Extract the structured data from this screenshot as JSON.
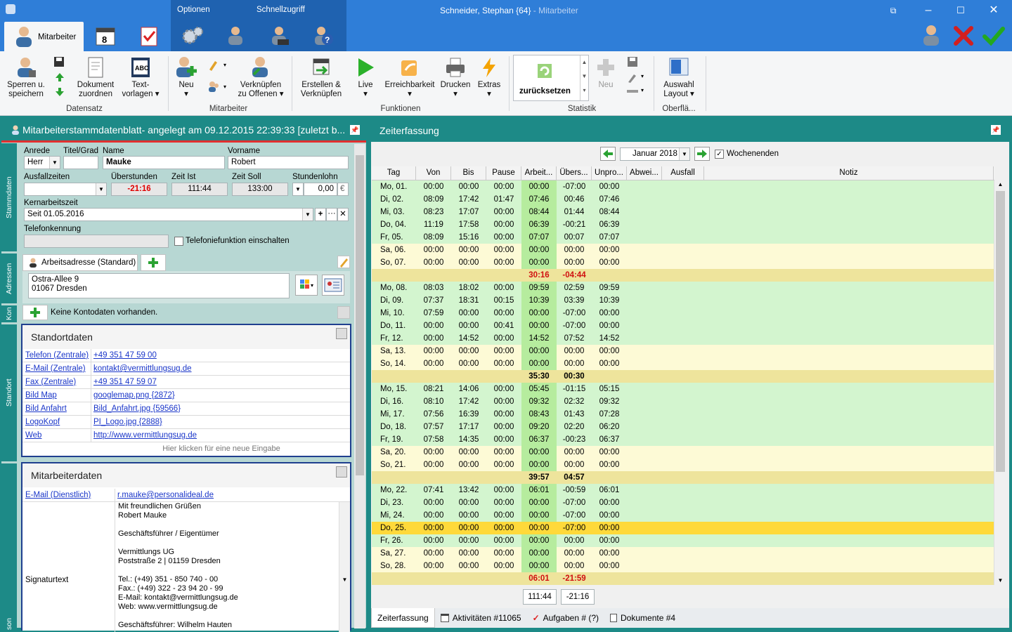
{
  "window": {
    "title": "Schneider, Stephan {64}",
    "subtitle": " - Mitarbeiter"
  },
  "topnav": {
    "tab_mitarbeiter": "Mitarbeiter",
    "optionen": "Optionen",
    "schnellzugriff": "Schnellzugriff"
  },
  "ribbon": {
    "sperren": "Sperren u.",
    "speichern": "speichern",
    "dokument1": "Dokument",
    "dokument2": "zuordnen",
    "text1": "Text-",
    "text2": "vorlagen",
    "neu": "Neu",
    "verkn1": "Verknüpfen",
    "verkn2": "zu Offenen",
    "erstellen1": "Erstellen &",
    "erstellen2": "Verknüpfen",
    "live": "Live",
    "erreich": "Erreichbarkeit",
    "drucken": "Drucken",
    "extras": "Extras",
    "zuruecksetzen": "zurücksetzen",
    "neu2": "Neu",
    "auswahl1": "Auswahl",
    "auswahl2": "Layout",
    "groups": {
      "datensatz": "Datensatz",
      "mitarbeiter": "Mitarbeiter",
      "funktionen": "Funktionen",
      "statistik": "Statistik",
      "oberflaeche": "Oberflä..."
    }
  },
  "left_panel": {
    "title": "Mitarbeiterstammdatenblatt- angelegt am 09.12.2015 22:39:33 [zuletzt b...",
    "side_tabs": {
      "stammdaten": "Stammdaten",
      "adressen": "Adressen",
      "kon": "Kon",
      "standort": "Standort",
      "son": "son"
    },
    "labels": {
      "anrede": "Anrede",
      "titel": "Titel/Grad",
      "name": "Name",
      "vorname": "Vorname",
      "ausfallzeiten": "Ausfallzeiten",
      "ueberstunden": "Überstunden",
      "zeit_ist": "Zeit Ist",
      "zeit_soll": "Zeit Soll",
      "stundenlohn": "Stundenlohn",
      "kernarbeitszeit": "Kernarbeitszeit",
      "telefonkennung": "Telefonkennung",
      "telefonie": "Telefoniefunktion einschalten"
    },
    "values": {
      "anrede": "Herr",
      "titel": "",
      "name": "Mauke",
      "vorname": "Robert",
      "ausfallzeiten": "",
      "ueberstunden": "-21:16",
      "zeit_ist": "111:44",
      "zeit_soll": "133:00",
      "stundenlohn": "0,00",
      "waehrung": "€",
      "kernarbeitszeit": "Seit 01.05.2016",
      "telefonkennung": ""
    },
    "adresse": {
      "tab": "Arbeitsadresse (Standard)",
      "line1": "Ostra-Allee 9",
      "line2": "01067 Dresden"
    },
    "konto": "Keine Kontodaten vorhanden.",
    "standort": {
      "title": "Standortdaten",
      "rows": [
        {
          "k": "Telefon (Zentrale)",
          "v": "+49 351 47 59 00"
        },
        {
          "k": "E-Mail (Zentrale)",
          "v": "kontakt@vermittlungsug.de"
        },
        {
          "k": "Fax (Zentrale)",
          "v": "+49 351 47 59 07"
        },
        {
          "k": "Bild Map",
          "v": "googlemap.png {2872}"
        },
        {
          "k": "Bild Anfahrt",
          "v": "Bild_Anfahrt.jpg {59566}"
        },
        {
          "k": "LogoKopf",
          "v": "PI_Logo.jpg {2888}"
        },
        {
          "k": "Web",
          "v": "http://www.vermittlungsug.de"
        }
      ],
      "new_entry": "Hier klicken für eine neue Eingabe"
    },
    "mitarbeiter": {
      "title": "Mitarbeiterdaten",
      "email_k": "E-Mail (Dienstlich)",
      "email_v": "r.mauke@personalideal.de",
      "sig_k": "Signaturtext",
      "sig_lines": [
        "Mit freundlichen Grüßen",
        "Robert Mauke",
        "",
        "Geschäftsführer / Eigentümer",
        "",
        "Vermittlungs UG",
        "Poststraße 2 | 01159 Dresden",
        "",
        "Tel.: (+49) 351 - 850 740 - 00",
        "Fax.: (+49) 322 - 23 94 20 - 99",
        "E-Mail: kontakt@vermittlungsug.de",
        "Web: www.vermittlungsug.de",
        "",
        "Geschäftsführer: Wilhelm Hauten"
      ]
    }
  },
  "right_panel": {
    "title": "Zeiterfassung",
    "month": "Januar 2018",
    "wochenenden": "Wochenenden",
    "headers": [
      "Tag",
      "Von",
      "Bis",
      "Pause",
      "Arbeit...",
      "Übers...",
      "Unpro...",
      "Abwei...",
      "Ausfall",
      "Notiz"
    ],
    "total_ist": "111:44",
    "total_ueber": "-21:16",
    "tabs": [
      "Zeiterfassung",
      "Aktivitäten #11065",
      "Aufgaben # (?)",
      "Dokumente #4"
    ]
  },
  "time_rows": [
    {
      "t": "d",
      "tag": "Mo, 01.",
      "von": "00:00",
      "bis": "00:00",
      "pause": "00:00",
      "arbeit": "00:00",
      "ueber": "-07:00",
      "unpro": "00:00"
    },
    {
      "t": "d",
      "tag": "Di, 02.",
      "von": "08:09",
      "bis": "17:42",
      "pause": "01:47",
      "arbeit": "07:46",
      "ueber": "00:46",
      "unpro": "07:46"
    },
    {
      "t": "d",
      "tag": "Mi, 03.",
      "von": "08:23",
      "bis": "17:07",
      "pause": "00:00",
      "arbeit": "08:44",
      "ueber": "01:44",
      "unpro": "08:44"
    },
    {
      "t": "d",
      "tag": "Do, 04.",
      "von": "11:19",
      "bis": "17:58",
      "pause": "00:00",
      "arbeit": "06:39",
      "ueber": "-00:21",
      "unpro": "06:39"
    },
    {
      "t": "d",
      "tag": "Fr, 05.",
      "von": "08:09",
      "bis": "15:16",
      "pause": "00:00",
      "arbeit": "07:07",
      "ueber": "00:07",
      "unpro": "07:07"
    },
    {
      "t": "w",
      "tag": "Sa, 06.",
      "von": "00:00",
      "bis": "00:00",
      "pause": "00:00",
      "arbeit": "00:00",
      "ueber": "00:00",
      "unpro": "00:00"
    },
    {
      "t": "w",
      "tag": "So, 07.",
      "von": "00:00",
      "bis": "00:00",
      "pause": "00:00",
      "arbeit": "00:00",
      "ueber": "00:00",
      "unpro": "00:00"
    },
    {
      "t": "s",
      "arbeit": "30:16",
      "ueber": "-04:44",
      "red": true
    },
    {
      "t": "d",
      "tag": "Mo, 08.",
      "von": "08:03",
      "bis": "18:02",
      "pause": "00:00",
      "arbeit": "09:59",
      "ueber": "02:59",
      "unpro": "09:59"
    },
    {
      "t": "d",
      "tag": "Di, 09.",
      "von": "07:37",
      "bis": "18:31",
      "pause": "00:15",
      "arbeit": "10:39",
      "ueber": "03:39",
      "unpro": "10:39"
    },
    {
      "t": "d",
      "tag": "Mi, 10.",
      "von": "07:59",
      "bis": "00:00",
      "pause": "00:00",
      "arbeit": "00:00",
      "ueber": "-07:00",
      "unpro": "00:00"
    },
    {
      "t": "d",
      "tag": "Do, 11.",
      "von": "00:00",
      "bis": "00:00",
      "pause": "00:41",
      "arbeit": "00:00",
      "ueber": "-07:00",
      "unpro": "00:00"
    },
    {
      "t": "d",
      "tag": "Fr, 12.",
      "von": "00:00",
      "bis": "14:52",
      "pause": "00:00",
      "arbeit": "14:52",
      "ueber": "07:52",
      "unpro": "14:52"
    },
    {
      "t": "w",
      "tag": "Sa, 13.",
      "von": "00:00",
      "bis": "00:00",
      "pause": "00:00",
      "arbeit": "00:00",
      "ueber": "00:00",
      "unpro": "00:00"
    },
    {
      "t": "w",
      "tag": "So, 14.",
      "von": "00:00",
      "bis": "00:00",
      "pause": "00:00",
      "arbeit": "00:00",
      "ueber": "00:00",
      "unpro": "00:00"
    },
    {
      "t": "s",
      "arbeit": "35:30",
      "ueber": "00:30",
      "red": false
    },
    {
      "t": "d",
      "tag": "Mo, 15.",
      "von": "08:21",
      "bis": "14:06",
      "pause": "00:00",
      "arbeit": "05:45",
      "ueber": "-01:15",
      "unpro": "05:15"
    },
    {
      "t": "d",
      "tag": "Di, 16.",
      "von": "08:10",
      "bis": "17:42",
      "pause": "00:00",
      "arbeit": "09:32",
      "ueber": "02:32",
      "unpro": "09:32"
    },
    {
      "t": "d",
      "tag": "Mi, 17.",
      "von": "07:56",
      "bis": "16:39",
      "pause": "00:00",
      "arbeit": "08:43",
      "ueber": "01:43",
      "unpro": "07:28"
    },
    {
      "t": "d",
      "tag": "Do, 18.",
      "von": "07:57",
      "bis": "17:17",
      "pause": "00:00",
      "arbeit": "09:20",
      "ueber": "02:20",
      "unpro": "06:20"
    },
    {
      "t": "d",
      "tag": "Fr, 19.",
      "von": "07:58",
      "bis": "14:35",
      "pause": "00:00",
      "arbeit": "06:37",
      "ueber": "-00:23",
      "unpro": "06:37"
    },
    {
      "t": "w",
      "tag": "Sa, 20.",
      "von": "00:00",
      "bis": "00:00",
      "pause": "00:00",
      "arbeit": "00:00",
      "ueber": "00:00",
      "unpro": "00:00"
    },
    {
      "t": "w",
      "tag": "So, 21.",
      "von": "00:00",
      "bis": "00:00",
      "pause": "00:00",
      "arbeit": "00:00",
      "ueber": "00:00",
      "unpro": "00:00"
    },
    {
      "t": "s",
      "arbeit": "39:57",
      "ueber": "04:57",
      "red": false
    },
    {
      "t": "d",
      "tag": "Mo, 22.",
      "von": "07:41",
      "bis": "13:42",
      "pause": "00:00",
      "arbeit": "06:01",
      "ueber": "-00:59",
      "unpro": "06:01"
    },
    {
      "t": "d",
      "tag": "Di, 23.",
      "von": "00:00",
      "bis": "00:00",
      "pause": "00:00",
      "arbeit": "00:00",
      "ueber": "-07:00",
      "unpro": "00:00"
    },
    {
      "t": "d",
      "tag": "Mi, 24.",
      "von": "00:00",
      "bis": "00:00",
      "pause": "00:00",
      "arbeit": "00:00",
      "ueber": "-07:00",
      "unpro": "00:00"
    },
    {
      "t": "h",
      "tag": "Do, 25.",
      "von": "00:00",
      "bis": "00:00",
      "pause": "00:00",
      "arbeit": "00:00",
      "ueber": "-07:00",
      "unpro": "00:00"
    },
    {
      "t": "d",
      "tag": "Fr, 26.",
      "von": "00:00",
      "bis": "00:00",
      "pause": "00:00",
      "arbeit": "00:00",
      "ueber": "00:00",
      "unpro": "00:00"
    },
    {
      "t": "w",
      "tag": "Sa, 27.",
      "von": "00:00",
      "bis": "00:00",
      "pause": "00:00",
      "arbeit": "00:00",
      "ueber": "00:00",
      "unpro": "00:00"
    },
    {
      "t": "w",
      "tag": "So, 28.",
      "von": "00:00",
      "bis": "00:00",
      "pause": "00:00",
      "arbeit": "00:00",
      "ueber": "00:00",
      "unpro": "00:00"
    },
    {
      "t": "s",
      "arbeit": "06:01",
      "ueber": "-21:59",
      "red": true
    }
  ],
  "colors": {
    "titlebar": "#2f7ed8",
    "teal": "#1d8a87",
    "day_bg": "#d3f5cf",
    "weekend_bg": "#fdfad6",
    "sum_bg": "#eee49c",
    "highlight_bg": "#ffd93a",
    "arbeit_col": "#b6ec9e",
    "red_text": "#d01010"
  }
}
